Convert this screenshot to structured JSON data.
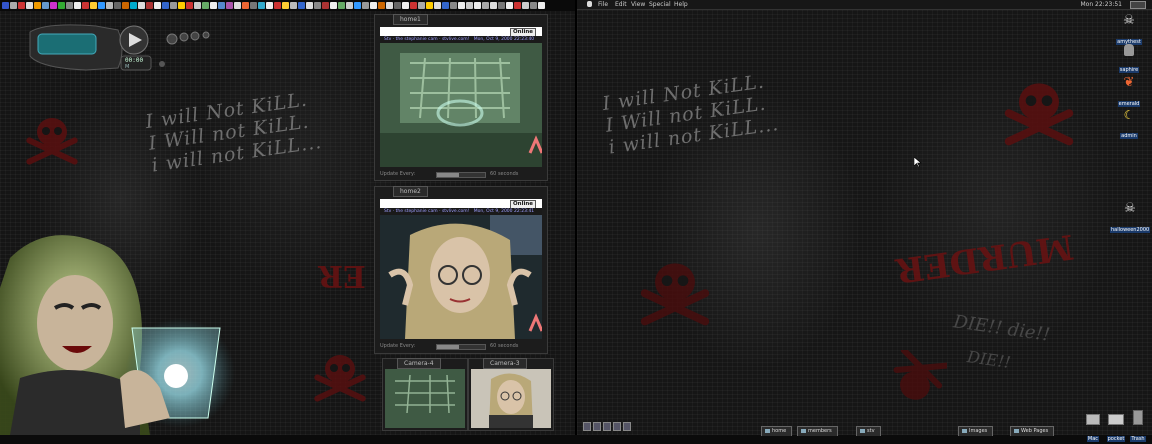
{
  "left_screen": {
    "graffiti": [
      "I will Not KiLL.",
      "I Will not KiLL.",
      "i will not KiLL..."
    ],
    "red_word": "ER"
  },
  "player": {
    "time": "00:00",
    "mode": "M"
  },
  "camera_windows": [
    {
      "tab": "home1",
      "header": "Stv · the stephanie cam · stvlive.com!",
      "date": "Mon, Oct 9, 2000  22:23:40",
      "status": "Online",
      "update_label": "Update Every:",
      "interval": "60 seconds",
      "progress": 0.45
    },
    {
      "tab": "home2",
      "header": "Stv · the stephanie cam · stvlive.com!",
      "date": "Mon, Oct 9, 2000  22:23:41",
      "status": "Online",
      "update_label": "Update Every:",
      "interval": "60 seconds",
      "progress": 0.45
    }
  ],
  "small_cameras": [
    {
      "label": "Camera-4"
    },
    {
      "label": "Camera-3"
    }
  ],
  "menubar": {
    "items": [
      "File",
      "Edit",
      "View",
      "Special",
      "Help"
    ],
    "clock": "Mon 22:23:51"
  },
  "right_screen": {
    "graffiti": [
      "I will Not KiLL.",
      "I Will not KiLL.",
      "i will not KiLL..."
    ],
    "red_word": "MURDER",
    "ghost_words": [
      "DIE!! die!!",
      "DIE!!"
    ]
  },
  "desktop_icons": [
    {
      "label": "amythest",
      "icon": "skull-icon"
    },
    {
      "label": "saphire",
      "icon": "bottle-icon"
    },
    {
      "label": "emerald",
      "icon": "leaf-icon"
    },
    {
      "label": "admin",
      "icon": "banana-icon"
    },
    {
      "label": "halloween2000",
      "icon": "skull-icon"
    }
  ],
  "bottom_tabs": [
    "home",
    "members",
    "stv",
    "Images",
    "Web Pages"
  ],
  "tray_icons": [
    {
      "label": "Mac"
    },
    {
      "label": "pocket"
    },
    {
      "label": "Trash"
    }
  ],
  "colors": {
    "accent_red": "#6a1212",
    "cam_green": "#6f9a75",
    "label_blue": "#1a3a6a"
  }
}
